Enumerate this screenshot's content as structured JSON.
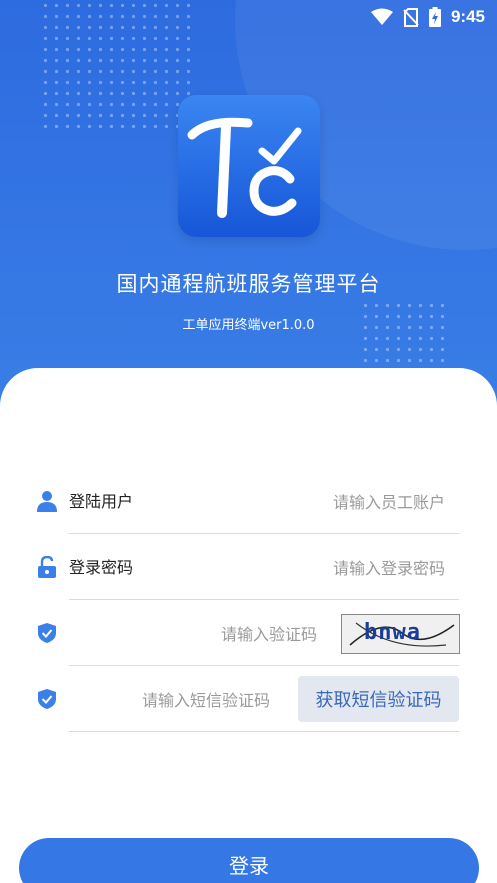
{
  "status_bar": {
    "time": "9:45",
    "icons": [
      "wifi-icon",
      "no-sim-icon",
      "battery-charging-icon"
    ]
  },
  "header": {
    "logo_letters": "Tč",
    "title": "国内通程航班服务管理平台",
    "subtitle": "工单应用终端ver1.0.0"
  },
  "form": {
    "username": {
      "label": "登陆用户",
      "placeholder": "请输入员工账户",
      "icon": "user-icon"
    },
    "password": {
      "label": "登录密码",
      "placeholder": "请输入登录密码",
      "icon": "unlock-icon"
    },
    "captcha": {
      "placeholder": "请输入验证码",
      "image_text": "bnwa",
      "icon": "shield-check-icon"
    },
    "sms": {
      "placeholder": "请输入短信验证码",
      "button": "获取短信验证码",
      "icon": "shield-check-icon"
    }
  },
  "login_button": "登录",
  "colors": {
    "primary": "#3578e5",
    "header_bg": "#2d6be0",
    "sms_button_bg": "#e3e8f0",
    "sms_button_text": "#3a67b8"
  }
}
